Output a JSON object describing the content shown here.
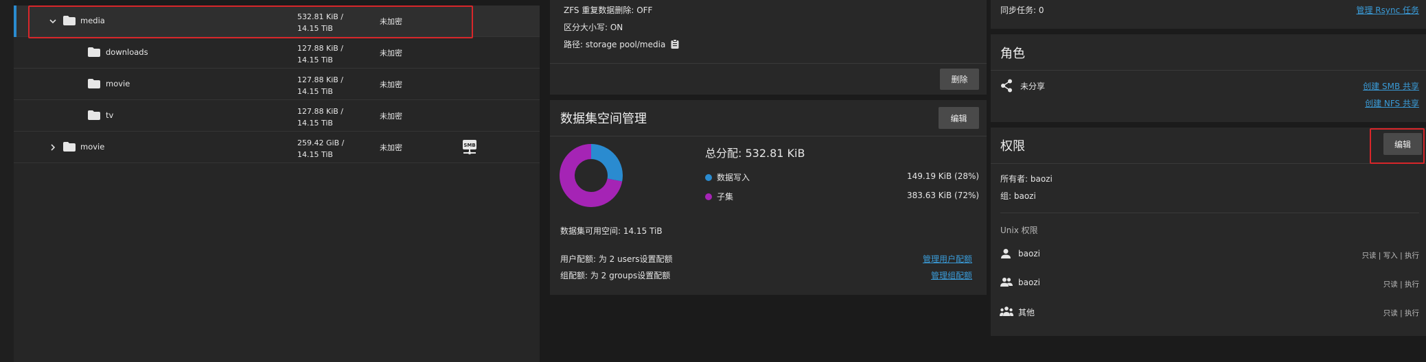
{
  "tree": {
    "rows": [
      {
        "name": "media",
        "used": "532.81 KiB /",
        "avail": "14.15 TiB",
        "encryption": "未加密",
        "expanded": true,
        "selected": true
      },
      {
        "name": "downloads",
        "used": "127.88 KiB /",
        "avail": "14.15 TiB",
        "encryption": "未加密"
      },
      {
        "name": "movie",
        "used": "127.88 KiB /",
        "avail": "14.15 TiB",
        "encryption": "未加密"
      },
      {
        "name": "tv",
        "used": "127.88 KiB /",
        "avail": "14.15 TiB",
        "encryption": "未加密"
      },
      {
        "name": "movie",
        "used": "259.42 GiB /",
        "avail": "14.15 TiB",
        "encryption": "未加密",
        "expanded": false,
        "smb_label": "SMB"
      }
    ]
  },
  "details": {
    "dedup": "ZFS 重复数据删除: OFF",
    "case": "区分大小写: ON",
    "path": "路径: storage pool/media",
    "delete_label": "删除"
  },
  "space": {
    "title": "数据集空间管理",
    "edit_label": "编辑",
    "total": "总分配:  532.81 KiB",
    "legend": [
      {
        "label": "数据写入",
        "value": "149.19 KiB (28%)",
        "color": "#2a8bd0"
      },
      {
        "label": "子集",
        "value": "383.63 KiB (72%)",
        "color": "#a524b5"
      }
    ],
    "available": "数据集可用空间: 14.15 TiB",
    "user_quota": "用户配额: 为 2 users设置配额",
    "user_quota_link": "管理用户配额",
    "group_quota": "组配额: 为 2 groups设置配额",
    "group_quota_link": "管理组配额"
  },
  "chart_data": {
    "type": "pie",
    "title": "",
    "categories": [
      "数据写入",
      "子集"
    ],
    "values": [
      28,
      72
    ],
    "colors": [
      "#2a8bd0",
      "#a524b5"
    ]
  },
  "sync": {
    "label": "同步任务: 0",
    "link": "管理 Rsync 任务"
  },
  "roles": {
    "title": "角色",
    "unshared": "未分享",
    "smb_link": "创建 SMB 共享",
    "nfs_link": "创建 NFS 共享"
  },
  "permissions": {
    "title": "权限",
    "edit_label": "编辑",
    "owner": "所有者:   baozi",
    "group": "组:   baozi",
    "unix_label": "Unix 权限",
    "entries": [
      {
        "name": "baozi",
        "perms": "只读 | 写入 | 执行"
      },
      {
        "name": "baozi",
        "perms": "只读 | 执行"
      },
      {
        "name": "其他",
        "perms": "只读 | 执行"
      }
    ]
  }
}
